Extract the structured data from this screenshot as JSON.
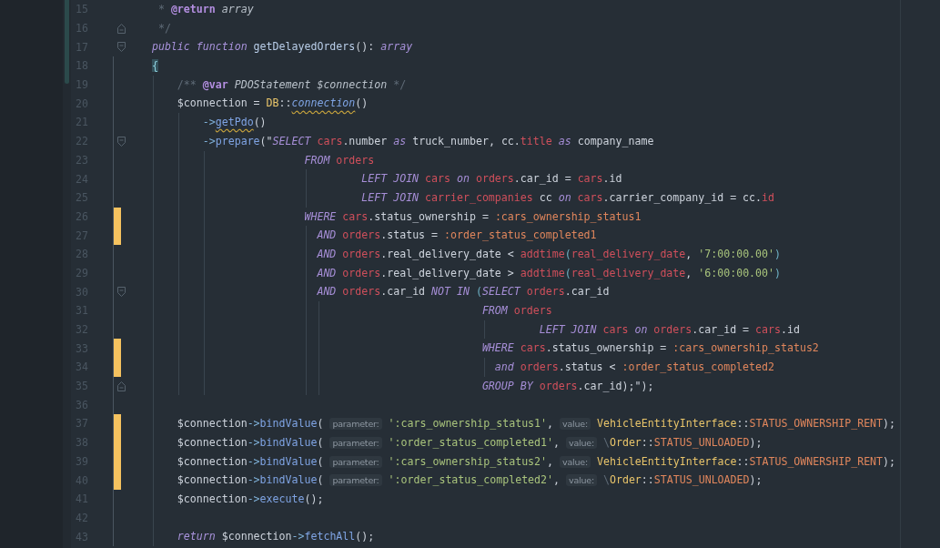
{
  "editor": {
    "lines": [
      {
        "number": "15",
        "changed": false,
        "fold_start": false,
        "fold_end": false,
        "tokens": [
          {
            "kind": "comment",
            "text": "     * "
          },
          {
            "kind": "doc-tag",
            "text": "@return"
          },
          {
            "kind": "doc-type",
            "text": " array"
          }
        ]
      },
      {
        "number": "16",
        "changed": false,
        "fold_start": false,
        "fold_end": true,
        "tokens": [
          {
            "kind": "comment",
            "text": "     */"
          }
        ]
      },
      {
        "number": "17",
        "changed": false,
        "fold_start": true,
        "fold_end": false,
        "tokens": [
          {
            "kind": "keyword",
            "text": "    public function"
          },
          {
            "kind": "method-name",
            "text": " getDelayedOrders"
          },
          {
            "kind": "plain",
            "text": "(): "
          },
          {
            "kind": "keyword",
            "text": "array"
          }
        ]
      },
      {
        "number": "18",
        "changed": false,
        "fold_start": false,
        "fold_end": false,
        "tokens": [
          {
            "kind": "matched-brace",
            "text": "    {"
          }
        ]
      },
      {
        "number": "19",
        "changed": false,
        "fold_start": false,
        "fold_end": false,
        "tokens": [
          {
            "kind": "comment",
            "text": "        /** "
          },
          {
            "kind": "doc-tag",
            "text": "@var"
          },
          {
            "kind": "doc-type",
            "text": " PDOStatement $connection"
          },
          {
            "kind": "comment",
            "text": " */"
          }
        ]
      },
      {
        "number": "20",
        "changed": false,
        "fold_start": false,
        "fold_end": false,
        "tokens": [
          {
            "kind": "plain",
            "text": "        $connection = "
          },
          {
            "kind": "class",
            "text": "DB"
          },
          {
            "kind": "plain",
            "text": "::"
          },
          {
            "kind": "warned-call",
            "text": "connection"
          },
          {
            "kind": "plain",
            "text": "()"
          }
        ]
      },
      {
        "number": "21",
        "changed": false,
        "fold_start": false,
        "fold_end": false,
        "tokens": [
          {
            "kind": "arrow",
            "text": "            ->"
          },
          {
            "kind": "warned-call",
            "text": "getPdo"
          },
          {
            "kind": "plain",
            "text": "()"
          }
        ]
      },
      {
        "number": "22",
        "changed": false,
        "fold_start": true,
        "fold_end": false,
        "tokens": [
          {
            "kind": "arrow",
            "text": "            ->"
          },
          {
            "kind": "function",
            "text": "prepare"
          },
          {
            "kind": "plain",
            "text": "(\""
          },
          {
            "kind": "sql-keyword",
            "text": "SELECT"
          },
          {
            "kind": "table",
            "text": " cars"
          },
          {
            "kind": "plain",
            "text": ".number "
          },
          {
            "kind": "sql-keyword",
            "text": "as"
          },
          {
            "kind": "plain",
            "text": " truck_number, cc."
          },
          {
            "kind": "table",
            "text": "title"
          },
          {
            "kind": "sql-keyword",
            "text": " as"
          },
          {
            "kind": "plain",
            "text": " company_name"
          }
        ]
      },
      {
        "number": "23",
        "changed": false,
        "fold_start": false,
        "fold_end": false,
        "tokens": [
          {
            "kind": "sql-keyword",
            "text": "                            FROM"
          },
          {
            "kind": "table",
            "text": " orders"
          }
        ]
      },
      {
        "number": "24",
        "changed": false,
        "fold_start": false,
        "fold_end": false,
        "tokens": [
          {
            "kind": "sql-keyword",
            "text": "                                     LEFT JOIN"
          },
          {
            "kind": "table",
            "text": " cars"
          },
          {
            "kind": "sql-keyword",
            "text": " on"
          },
          {
            "kind": "table",
            "text": " orders"
          },
          {
            "kind": "plain",
            "text": ".car_id = "
          },
          {
            "kind": "table",
            "text": "cars"
          },
          {
            "kind": "plain",
            "text": ".id"
          }
        ]
      },
      {
        "number": "25",
        "changed": false,
        "fold_start": false,
        "fold_end": false,
        "tokens": [
          {
            "kind": "sql-keyword",
            "text": "                                     LEFT JOIN"
          },
          {
            "kind": "table",
            "text": " carrier_companies"
          },
          {
            "kind": "plain",
            "text": " cc"
          },
          {
            "kind": "sql-keyword",
            "text": " on"
          },
          {
            "kind": "table",
            "text": " cars"
          },
          {
            "kind": "plain",
            "text": ".carrier_company_id = cc."
          },
          {
            "kind": "table",
            "text": "id"
          }
        ]
      },
      {
        "number": "26",
        "changed": true,
        "fold_start": false,
        "fold_end": false,
        "tokens": [
          {
            "kind": "sql-keyword",
            "text": "                            WHERE"
          },
          {
            "kind": "table",
            "text": " cars"
          },
          {
            "kind": "plain",
            "text": ".status_ownership = "
          },
          {
            "kind": "param",
            "text": ":cars_ownership_status1"
          }
        ]
      },
      {
        "number": "27",
        "changed": true,
        "fold_start": false,
        "fold_end": false,
        "tokens": [
          {
            "kind": "sql-keyword",
            "text": "                              AND"
          },
          {
            "kind": "table",
            "text": " orders"
          },
          {
            "kind": "plain",
            "text": ".status = "
          },
          {
            "kind": "param",
            "text": ":order_status_completed1"
          }
        ]
      },
      {
        "number": "28",
        "changed": false,
        "fold_start": false,
        "fold_end": false,
        "tokens": [
          {
            "kind": "sql-keyword",
            "text": "                              AND"
          },
          {
            "kind": "table",
            "text": " orders"
          },
          {
            "kind": "plain",
            "text": ".real_delivery_date < "
          },
          {
            "kind": "table",
            "text": "addtime"
          },
          {
            "kind": "accent",
            "text": "("
          },
          {
            "kind": "table",
            "text": "real_delivery_date"
          },
          {
            "kind": "plain",
            "text": ", "
          },
          {
            "kind": "string",
            "text": "'7:00:00.00'"
          },
          {
            "kind": "accent",
            "text": ")"
          }
        ]
      },
      {
        "number": "29",
        "changed": false,
        "fold_start": false,
        "fold_end": false,
        "tokens": [
          {
            "kind": "sql-keyword",
            "text": "                              AND"
          },
          {
            "kind": "table",
            "text": " orders"
          },
          {
            "kind": "plain",
            "text": ".real_delivery_date > "
          },
          {
            "kind": "table",
            "text": "addtime"
          },
          {
            "kind": "accent",
            "text": "("
          },
          {
            "kind": "table",
            "text": "real_delivery_date"
          },
          {
            "kind": "plain",
            "text": ", "
          },
          {
            "kind": "string",
            "text": "'6:00:00.00'"
          },
          {
            "kind": "accent",
            "text": ")"
          }
        ]
      },
      {
        "number": "30",
        "changed": false,
        "fold_start": true,
        "fold_end": false,
        "tokens": [
          {
            "kind": "sql-keyword",
            "text": "                              AND"
          },
          {
            "kind": "table",
            "text": " orders"
          },
          {
            "kind": "plain",
            "text": ".car_id "
          },
          {
            "kind": "sql-keyword",
            "text": "NOT IN"
          },
          {
            "kind": "accent",
            "text": " ("
          },
          {
            "kind": "sql-keyword",
            "text": "SELECT"
          },
          {
            "kind": "table",
            "text": " orders"
          },
          {
            "kind": "plain",
            "text": ".car_id"
          }
        ]
      },
      {
        "number": "31",
        "changed": false,
        "fold_start": false,
        "fold_end": false,
        "tokens": [
          {
            "kind": "sql-keyword",
            "text": "                                                        FROM"
          },
          {
            "kind": "table",
            "text": " orders"
          }
        ]
      },
      {
        "number": "32",
        "changed": false,
        "fold_start": false,
        "fold_end": false,
        "tokens": [
          {
            "kind": "sql-keyword",
            "text": "                                                                 LEFT JOIN"
          },
          {
            "kind": "table",
            "text": " cars"
          },
          {
            "kind": "sql-keyword",
            "text": " on"
          },
          {
            "kind": "table",
            "text": " orders"
          },
          {
            "kind": "plain",
            "text": ".car_id = "
          },
          {
            "kind": "table",
            "text": "cars"
          },
          {
            "kind": "plain",
            "text": ".id"
          }
        ]
      },
      {
        "number": "33",
        "changed": true,
        "fold_start": false,
        "fold_end": false,
        "tokens": [
          {
            "kind": "sql-keyword",
            "text": "                                                        WHERE"
          },
          {
            "kind": "table",
            "text": " cars"
          },
          {
            "kind": "plain",
            "text": ".status_ownership = "
          },
          {
            "kind": "param",
            "text": ":cars_ownership_status2"
          }
        ]
      },
      {
        "number": "34",
        "changed": true,
        "fold_start": false,
        "fold_end": false,
        "tokens": [
          {
            "kind": "sql-keyword",
            "text": "                                                          and"
          },
          {
            "kind": "table",
            "text": " orders"
          },
          {
            "kind": "plain",
            "text": ".status < "
          },
          {
            "kind": "param",
            "text": ":order_status_completed2"
          }
        ]
      },
      {
        "number": "35",
        "changed": false,
        "fold_start": false,
        "fold_end": true,
        "tokens": [
          {
            "kind": "sql-keyword",
            "text": "                                                        GROUP BY"
          },
          {
            "kind": "table",
            "text": " orders"
          },
          {
            "kind": "plain",
            "text": ".car_id);\");"
          }
        ]
      },
      {
        "number": "36",
        "changed": false,
        "fold_start": false,
        "fold_end": false
      },
      {
        "number": "37",
        "changed": true,
        "fold_start": false,
        "fold_end": false,
        "tokens": [
          {
            "kind": "plain",
            "text": "        $connection"
          },
          {
            "kind": "arrow",
            "text": "->"
          },
          {
            "kind": "function",
            "text": "bindValue"
          },
          {
            "kind": "plain",
            "text": "( "
          },
          {
            "kind": "hint",
            "text": "parameter:"
          },
          {
            "kind": "string",
            "text": " ':cars_ownership_status1'"
          },
          {
            "kind": "plain",
            "text": ", "
          },
          {
            "kind": "hint",
            "text": "value:"
          },
          {
            "kind": "class",
            "text": " VehicleEntityInterface"
          },
          {
            "kind": "plain",
            "text": "::"
          },
          {
            "kind": "constant",
            "text": "STATUS_OWNERSHIP_RENT"
          },
          {
            "kind": "plain",
            "text": ");"
          }
        ]
      },
      {
        "number": "38",
        "changed": true,
        "fold_start": false,
        "fold_end": false,
        "tokens": [
          {
            "kind": "plain",
            "text": "        $connection"
          },
          {
            "kind": "arrow",
            "text": "->"
          },
          {
            "kind": "function",
            "text": "bindValue"
          },
          {
            "kind": "plain",
            "text": "( "
          },
          {
            "kind": "hint",
            "text": "parameter:"
          },
          {
            "kind": "string",
            "text": " ':order_status_completed1'"
          },
          {
            "kind": "plain",
            "text": ", "
          },
          {
            "kind": "hint",
            "text": "value:"
          },
          {
            "kind": "comment",
            "text": " \\"
          },
          {
            "kind": "class",
            "text": "Order"
          },
          {
            "kind": "plain",
            "text": "::"
          },
          {
            "kind": "constant",
            "text": "STATUS_UNLOADED"
          },
          {
            "kind": "plain",
            "text": ");"
          }
        ]
      },
      {
        "number": "39",
        "changed": true,
        "fold_start": false,
        "fold_end": false,
        "tokens": [
          {
            "kind": "plain",
            "text": "        $connection"
          },
          {
            "kind": "arrow",
            "text": "->"
          },
          {
            "kind": "function",
            "text": "bindValue"
          },
          {
            "kind": "plain",
            "text": "( "
          },
          {
            "kind": "hint",
            "text": "parameter:"
          },
          {
            "kind": "string",
            "text": " ':cars_ownership_status2'"
          },
          {
            "kind": "plain",
            "text": ", "
          },
          {
            "kind": "hint",
            "text": "value:"
          },
          {
            "kind": "class",
            "text": " VehicleEntityInterface"
          },
          {
            "kind": "plain",
            "text": "::"
          },
          {
            "kind": "constant",
            "text": "STATUS_OWNERSHIP_RENT"
          },
          {
            "kind": "plain",
            "text": ");"
          }
        ]
      },
      {
        "number": "40",
        "changed": true,
        "fold_start": false,
        "fold_end": false,
        "tokens": [
          {
            "kind": "plain",
            "text": "        $connection"
          },
          {
            "kind": "arrow",
            "text": "->"
          },
          {
            "kind": "function",
            "text": "bindValue"
          },
          {
            "kind": "plain",
            "text": "( "
          },
          {
            "kind": "hint",
            "text": "parameter:"
          },
          {
            "kind": "string",
            "text": " ':order_status_completed2'"
          },
          {
            "kind": "plain",
            "text": ", "
          },
          {
            "kind": "hint",
            "text": "value:"
          },
          {
            "kind": "comment",
            "text": " \\"
          },
          {
            "kind": "class",
            "text": "Order"
          },
          {
            "kind": "plain",
            "text": "::"
          },
          {
            "kind": "constant",
            "text": "STATUS_UNLOADED"
          },
          {
            "kind": "plain",
            "text": ");"
          }
        ]
      },
      {
        "number": "41",
        "changed": false,
        "fold_start": false,
        "fold_end": false,
        "tokens": [
          {
            "kind": "plain",
            "text": "        $connection"
          },
          {
            "kind": "arrow",
            "text": "->"
          },
          {
            "kind": "function",
            "text": "execute"
          },
          {
            "kind": "plain",
            "text": "();"
          }
        ]
      },
      {
        "number": "42",
        "changed": false,
        "fold_start": false,
        "fold_end": false
      },
      {
        "number": "43",
        "changed": false,
        "fold_start": false,
        "fold_end": false,
        "tokens": [
          {
            "kind": "keyword",
            "text": "        return"
          },
          {
            "kind": "plain",
            "text": " $connection"
          },
          {
            "kind": "arrow",
            "text": "->"
          },
          {
            "kind": "function",
            "text": "fetchAll"
          },
          {
            "kind": "plain",
            "text": "();"
          }
        ]
      }
    ]
  }
}
